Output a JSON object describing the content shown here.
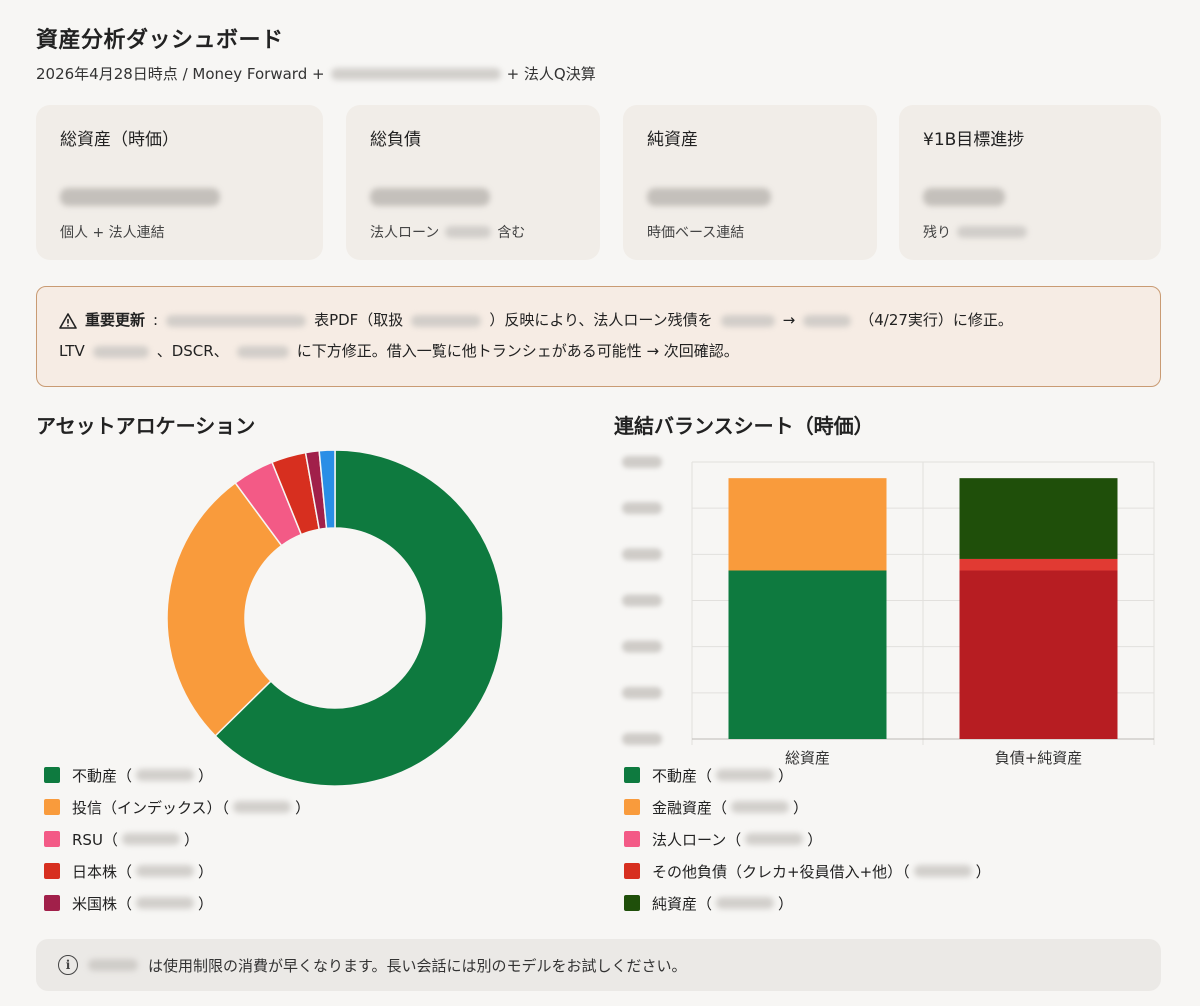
{
  "header": {
    "title": "資産分析ダッシュボード",
    "subtitle_prefix": "2026年4月28日時点 / Money Forward +",
    "subtitle_suffix": "+ 法人Q決算"
  },
  "cards": [
    {
      "label": "総資産（時価）",
      "sub_prefix": "個人 + 法人連結",
      "sub_suffix": ""
    },
    {
      "label": "総負債",
      "sub_prefix": "法人ローン",
      "sub_suffix": "含む"
    },
    {
      "label": "純資産",
      "sub_prefix": "時価ベース連結",
      "sub_suffix": ""
    },
    {
      "label": "¥1B目標進捗",
      "sub_prefix": "残り",
      "sub_suffix": ""
    }
  ],
  "alert": {
    "icon": "warning-icon",
    "heading": "重要更新",
    "l1_a": "表PDF（取扱",
    "l1_b": "）反映により、法人ローン残債を",
    "l1_arrow": "→",
    "l1_c": "（4/27実行）に修正。",
    "l2_a": "LTV",
    "l2_b": "、DSCR、",
    "l2_c": "に下方修正。借入一覧に他トランシェがある可能性 → 次回確認。"
  },
  "allocation": {
    "title": "アセットアロケーション",
    "legend": [
      {
        "label": "不動産（",
        "suffix": "）",
        "color": "#0e7a3f"
      },
      {
        "label": "投信（インデックス）（",
        "suffix": "）",
        "color": "#f99b3c"
      },
      {
        "label": "RSU（",
        "suffix": "）",
        "color": "#f35a86"
      },
      {
        "label": "日本株（",
        "suffix": "）",
        "color": "#d72f1f"
      },
      {
        "label": "米国株（",
        "suffix": "）",
        "color": "#a1204a"
      }
    ]
  },
  "balance": {
    "title": "連結バランスシート（時価）",
    "legend": [
      {
        "label": "不動産（",
        "suffix": "）",
        "color": "#0e7a3f"
      },
      {
        "label": "金融資産（",
        "suffix": "）",
        "color": "#f99b3c"
      },
      {
        "label": "法人ローン（",
        "suffix": "）",
        "color": "#f35a86"
      },
      {
        "label": "その他負債（クレカ+役員借入+他）（",
        "suffix": "）",
        "color": "#d72f1f"
      },
      {
        "label": "純資産（",
        "suffix": "）",
        "color": "#1f4f0a"
      }
    ]
  },
  "chart_data": [
    {
      "type": "pie",
      "title": "アセットアロケーション",
      "donut": true,
      "labels": [
        "不動産",
        "投信（インデックス）",
        "RSU",
        "日本株",
        "米国株",
        "(other)"
      ],
      "values": [
        62.5,
        27.2,
        4.0,
        3.3,
        1.3,
        1.5
      ],
      "colors": [
        "#0e7a3f",
        "#f99b3c",
        "#f35a86",
        "#d72f1f",
        "#a1204a",
        "#2a8ee6"
      ]
    },
    {
      "type": "bar",
      "stacked": true,
      "title": "連結バランスシート（時価）",
      "categories": [
        "総資産",
        "負債+純資産"
      ],
      "series": [
        {
          "name": "不動産",
          "values": [
            73,
            0
          ],
          "color": "#0e7a3f"
        },
        {
          "name": "金融資産",
          "values": [
            40,
            0
          ],
          "color": "#f99b3c"
        },
        {
          "name": "法人ローン",
          "values": [
            0,
            73
          ],
          "color": "#b71d22"
        },
        {
          "name": "その他負債（クレカ+役員借入+他）",
          "values": [
            0,
            5
          ],
          "color": "#e13a33"
        },
        {
          "name": "純資産",
          "values": [
            0,
            35
          ],
          "color": "#1f4f0a"
        }
      ],
      "ylim": [
        0,
        120
      ],
      "grid": true
    }
  ],
  "footer": {
    "icon": "info-icon",
    "text": "は使用制限の消費が早くなります。長い会話には別のモデルをお試しください。"
  }
}
